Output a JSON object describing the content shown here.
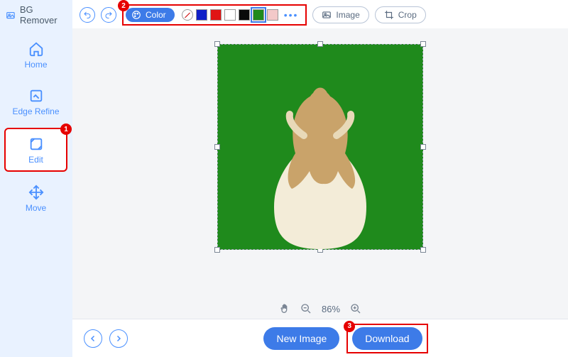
{
  "brand": {
    "name": "BG Remover"
  },
  "sidebar": {
    "items": [
      {
        "label": "Home"
      },
      {
        "label": "Edge Refine"
      },
      {
        "label": "Edit"
      },
      {
        "label": "Move"
      }
    ]
  },
  "toolbar": {
    "color_label": "Color",
    "image_label": "Image",
    "crop_label": "Crop",
    "swatches": {
      "none": "transparent",
      "blue": "#1020c8",
      "red": "#e01414",
      "white": "#ffffff",
      "black": "#0a0a0a",
      "green": "#1f8a1c",
      "pink": "#f3c9c9"
    },
    "selected_swatch": "green"
  },
  "canvas": {
    "zoom_text": "86%",
    "bg_color": "#1f8a1c"
  },
  "footer": {
    "new_image_label": "New Image",
    "download_label": "Download"
  },
  "callouts": {
    "edit": "1",
    "color": "2",
    "download": "3"
  }
}
